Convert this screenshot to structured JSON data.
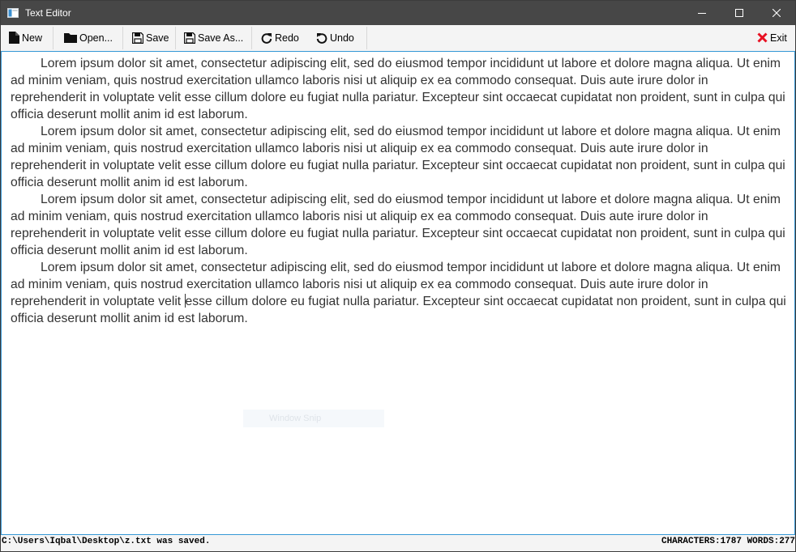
{
  "window": {
    "title": "Text Editor",
    "controls": [
      "minimize-icon",
      "maximize-icon",
      "close-icon"
    ]
  },
  "toolbar": {
    "new_label": "New",
    "open_label": "Open...",
    "save_label": "Save",
    "save_as_label": "Save As...",
    "redo_label": "Redo",
    "undo_label": "Undo",
    "exit_label": "Exit",
    "icons": [
      "file-icon",
      "folder-icon",
      "save-icon",
      "save-as-icon",
      "redo-icon",
      "undo-icon",
      "exit-icon"
    ],
    "exit_icon_color": "#e81123"
  },
  "editor": {
    "paragraphs": [
      "Lorem ipsum dolor sit amet, consectetur adipiscing elit, sed do eiusmod tempor incididunt ut labore et dolore magna aliqua. Ut enim ad minim veniam, quis nostrud exercitation ullamco laboris nisi ut aliquip ex ea commodo consequat. Duis aute irure dolor in reprehenderit in voluptate velit esse cillum dolore eu fugiat nulla pariatur. Excepteur sint occaecat cupidatat non proident, sunt in culpa qui officia deserunt mollit anim id est laborum.",
      "Lorem ipsum dolor sit amet, consectetur adipiscing elit, sed do eiusmod tempor incididunt ut labore et dolore magna aliqua. Ut enim ad minim veniam, quis nostrud exercitation ullamco laboris nisi ut aliquip ex ea commodo consequat. Duis aute irure dolor in reprehenderit in voluptate velit esse cillum dolore eu fugiat nulla pariatur. Excepteur sint occaecat cupidatat non proident, sunt in culpa qui officia deserunt mollit anim id est laborum.",
      "Lorem ipsum dolor sit amet, consectetur adipiscing elit, sed do eiusmod tempor incididunt ut labore et dolore magna aliqua. Ut enim ad minim veniam, quis nostrud exercitation ullamco laboris nisi ut aliquip ex ea commodo consequat. Duis aute irure dolor in reprehenderit in voluptate velit esse cillum dolore eu fugiat nulla pariatur. Excepteur sint occaecat cupidatat non proident, sunt in culpa qui officia deserunt mollit anim id est laborum."
    ],
    "last_paragraph_before_caret": "Lorem ipsum dolor sit amet, consectetur adipiscing elit, sed do eiusmod tempor incididunt ut labore et dolore magna aliqua. Ut enim ad minim veniam, quis nostrud exercitation ullamco laboris nisi ut aliquip ex ea commodo consequat. Duis aute irure dolor in reprehenderit in voluptate velit ",
    "last_paragraph_after_caret": "esse cillum dolore eu fugiat nulla pariatur. Excepteur sint occaecat cupidatat non proident, sunt in culpa qui officia deserunt mollit anim id est laborum.",
    "ghost_label": "Window Snip"
  },
  "status": {
    "message": "C:\\Users\\Iqbal\\Desktop\\z.txt was saved.",
    "counts": "CHARACTERS:1787 WORDS:277"
  },
  "colors": {
    "titlebar": "#474747",
    "editor_border": "#3598d6",
    "text": "#333333"
  }
}
